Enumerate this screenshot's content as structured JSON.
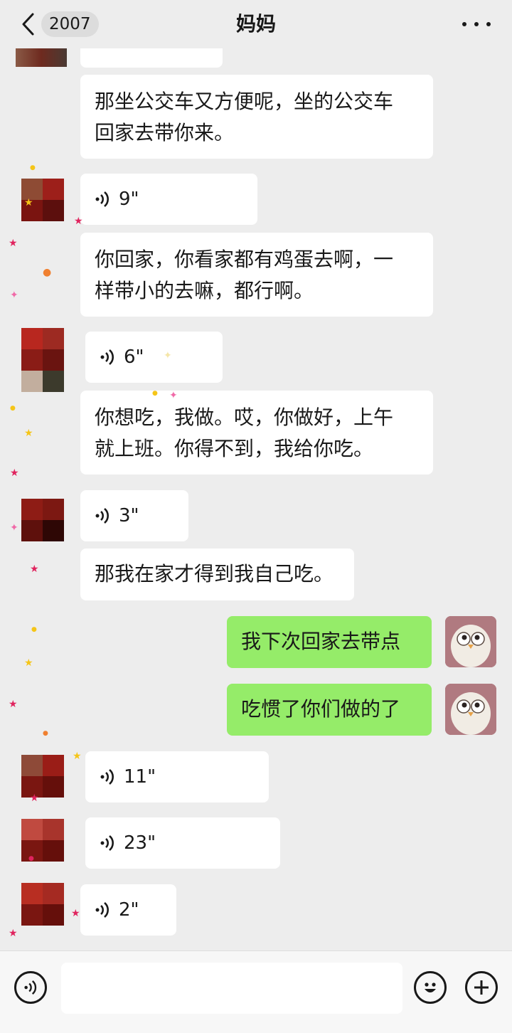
{
  "header": {
    "unread_count": "2007",
    "title": "妈妈"
  },
  "messages": [
    {
      "type": "text",
      "text": "那坐公交车又方便呢，坐的公交车\n回家去带你来。"
    },
    {
      "type": "voice",
      "duration": "9\""
    },
    {
      "type": "text",
      "text": "你回家，你看家都有鸡蛋去啊，一\n样带小的去嘛，都行啊。"
    },
    {
      "type": "voice",
      "duration": "6\""
    },
    {
      "type": "text",
      "text": "你想吃，我做。哎，你做好，上午\n就上班。你得不到，我给你吃。"
    },
    {
      "type": "voice",
      "duration": "3\""
    },
    {
      "type": "text",
      "text": "那我在家才得到我自己吃。"
    },
    {
      "type": "text_out",
      "text": "我下次回家去带点"
    },
    {
      "type": "text_out",
      "text": "吃惯了你们做的了"
    },
    {
      "type": "voice",
      "duration": "11\""
    },
    {
      "type": "voice",
      "duration": "23\""
    },
    {
      "type": "voice",
      "duration": "2\""
    }
  ],
  "input": {
    "placeholder": ""
  },
  "icons": {
    "back": "chevron-left-icon",
    "more": "more-dots-icon",
    "voice_input": "voice-icon",
    "emoji": "emoji-icon",
    "add": "plus-icon"
  },
  "colors": {
    "background": "#ededed",
    "incoming_bubble": "#ffffff",
    "outgoing_bubble": "#95ec69"
  }
}
